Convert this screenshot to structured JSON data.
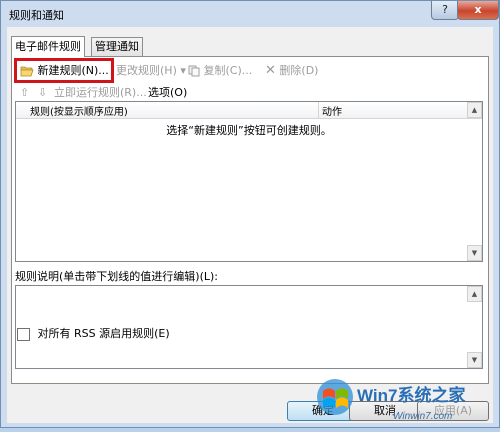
{
  "window": {
    "title": "规则和通知",
    "help_label": "?",
    "close_label": "x"
  },
  "tabs": [
    {
      "label": "电子邮件规则",
      "active": true
    },
    {
      "label": "管理通知",
      "active": false
    }
  ],
  "toolbar": {
    "new_rule": "新建规则(N)...",
    "change_rule": "更改规则(H)",
    "copy": "复制(C)...",
    "delete": "删除(D)"
  },
  "subbar": {
    "run_rules": "立即运行规则(R)...",
    "options": "选项(O)"
  },
  "rules_list": {
    "col_rule": "规则(按显示顺序应用)",
    "col_action": "动作",
    "empty_message": "选择“新建规则”按钮可创建规则。"
  },
  "description": {
    "label": "规则说明(单击带下划线的值进行编辑)(L):"
  },
  "rss": {
    "label": "对所有 RSS 源启用规则(E)",
    "checked": false
  },
  "buttons": {
    "ok": "确定",
    "cancel": "取消",
    "apply": "应用(A)"
  },
  "watermark": {
    "brand": "Win7系统之家",
    "url": "Winwin7.com"
  },
  "colors": {
    "highlight_border": "#d0151a",
    "close_button": "#c8452f",
    "title_bar": "#cddcee"
  }
}
